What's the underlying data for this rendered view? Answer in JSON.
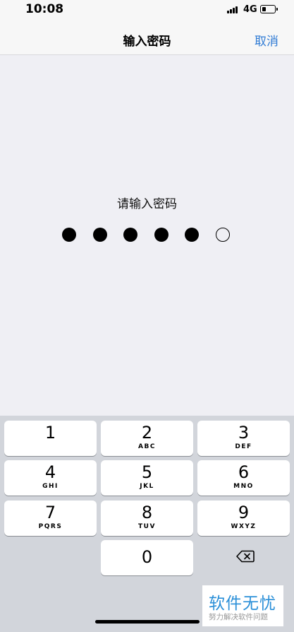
{
  "status_bar": {
    "time": "10:08",
    "network": "4G"
  },
  "nav": {
    "title": "输入密码",
    "cancel_label": "取消"
  },
  "passcode": {
    "prompt": "请输入密码",
    "entered": 5,
    "length": 6
  },
  "keypad": {
    "keys": [
      {
        "digit": "1",
        "letters": ""
      },
      {
        "digit": "2",
        "letters": "ABC"
      },
      {
        "digit": "3",
        "letters": "DEF"
      },
      {
        "digit": "4",
        "letters": "GHI"
      },
      {
        "digit": "5",
        "letters": "JKL"
      },
      {
        "digit": "6",
        "letters": "MNO"
      },
      {
        "digit": "7",
        "letters": "PQRS"
      },
      {
        "digit": "8",
        "letters": "TUV"
      },
      {
        "digit": "9",
        "letters": "WXYZ"
      },
      {
        "digit": "0",
        "letters": ""
      }
    ],
    "delete_icon": "backspace-icon"
  },
  "watermark": {
    "main": "软件无忧",
    "sub": "努力解决软件问题"
  },
  "colors": {
    "accent": "#2f7bd4",
    "keypad_bg": "#d2d5db",
    "page_bg": "#efeff4",
    "watermark": "#2a8fd8"
  }
}
